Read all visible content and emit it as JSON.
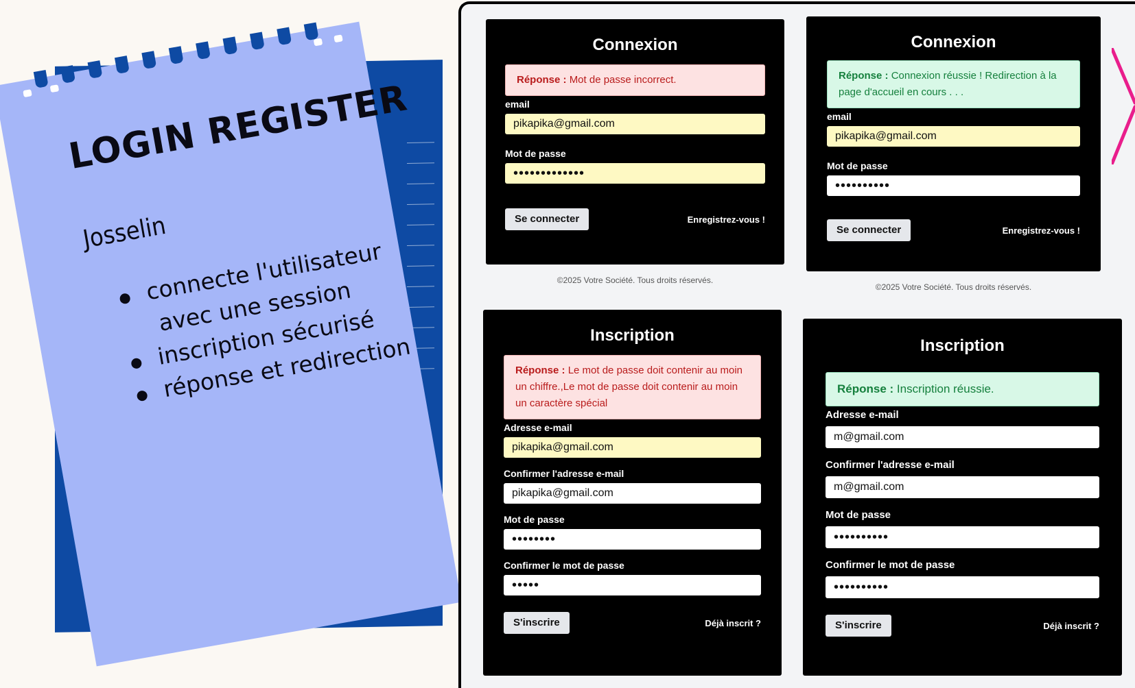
{
  "note": {
    "title": "LOGIN REGISTER",
    "author": "Josselin",
    "bullets": [
      {
        "line1": "connecte l'utilisateur",
        "line2": "avec une session"
      },
      {
        "line1": "inscription sécurisé",
        "line2": ""
      },
      {
        "line1": "réponse et redirection",
        "line2": ""
      }
    ]
  },
  "login_error": {
    "title": "Connexion",
    "alert_prefix": "Réponse :",
    "alert_text": "Mot de passe incorrect.",
    "email_label": "email",
    "email_value": "pikapika@gmail.com",
    "password_label": "Mot de passe",
    "password_value": "•••••••••••••",
    "submit_label": "Se connecter",
    "register_link": "Enregistrez-vous !",
    "footer": "©2025 Votre Société. Tous droits réservés."
  },
  "login_success": {
    "title": "Connexion",
    "alert_prefix": "Réponse :",
    "alert_text": "Connexion réussie ! Redirection à la page d'accueil en cours . . .",
    "email_label": "email",
    "email_value": "pikapika@gmail.com",
    "password_label": "Mot de passe",
    "password_value": "••••••••••",
    "submit_label": "Se connecter",
    "register_link": "Enregistrez-vous !",
    "footer": "©2025 Votre Société. Tous droits réservés."
  },
  "register_error": {
    "title": "Inscription",
    "alert_prefix": "Réponse :",
    "alert_text": "Le mot de passe doit contenir au moin un chiffre.,Le mot de passe doit contenir au moin un caractère spécial",
    "email_label": "Adresse e-mail",
    "email_value": "pikapika@gmail.com",
    "confirm_email_label": "Confirmer l'adresse e-mail",
    "confirm_email_value": "pikapika@gmail.com",
    "password_label": "Mot de passe",
    "password_value": "••••••••",
    "confirm_password_label": "Confirmer le mot de passe",
    "confirm_password_value": "•••••",
    "submit_label": "S'inscrire",
    "login_link": "Déjà inscrit ?"
  },
  "register_success": {
    "title": "Inscription",
    "alert_prefix": "Réponse :",
    "alert_text": "Inscription réussie.",
    "email_label": "Adresse e-mail",
    "email_value": "m@gmail.com",
    "confirm_email_label": "Confirmer l'adresse e-mail",
    "confirm_email_value": "m@gmail.com",
    "password_label": "Mot de passe",
    "password_value": "••••••••••",
    "confirm_password_label": "Confirmer le mot de passe",
    "confirm_password_value": "••••••••••",
    "submit_label": "S'inscrire",
    "login_link": "Déjà inscrit ?"
  },
  "colors": {
    "note_front": "#a5b6f8",
    "note_back": "#0e4aa3",
    "card_bg": "#000000",
    "error_bg": "#fde2e2",
    "success_bg": "#d8f8e7",
    "autofill_bg": "#fef9c3",
    "accent_pink": "#e91e8c"
  }
}
